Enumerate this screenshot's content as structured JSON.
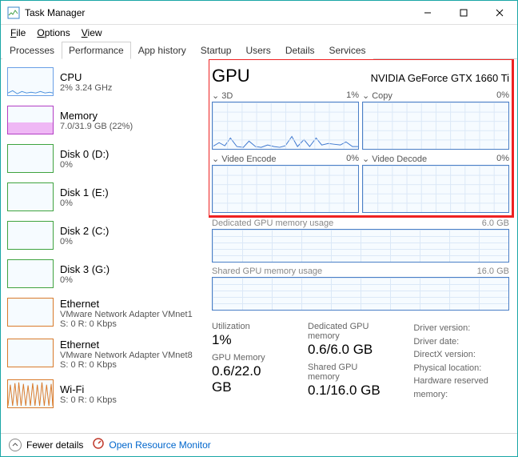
{
  "window": {
    "title": "Task Manager"
  },
  "menu": {
    "file": "File",
    "options": "Options",
    "view": "View"
  },
  "tabs": [
    "Processes",
    "Performance",
    "App history",
    "Startup",
    "Users",
    "Details",
    "Services"
  ],
  "activeTab": "Performance",
  "sidebar": [
    {
      "name": "CPU",
      "sub": "2% 3.24 GHz",
      "kind": "cpu"
    },
    {
      "name": "Memory",
      "sub": "7.0/31.9 GB (22%)",
      "kind": "mem"
    },
    {
      "name": "Disk 0 (D:)",
      "sub": "0%",
      "kind": "disk"
    },
    {
      "name": "Disk 1 (E:)",
      "sub": "0%",
      "kind": "disk"
    },
    {
      "name": "Disk 2 (C:)",
      "sub": "0%",
      "kind": "disk"
    },
    {
      "name": "Disk 3 (G:)",
      "sub": "0%",
      "kind": "disk"
    },
    {
      "name": "Ethernet",
      "sub": "VMware Network Adapter VMnet1",
      "sub2": "S: 0 R: 0 Kbps",
      "kind": "eth"
    },
    {
      "name": "Ethernet",
      "sub": "VMware Network Adapter VMnet8",
      "sub2": "S: 0 R: 0 Kbps",
      "kind": "eth"
    },
    {
      "name": "Wi-Fi",
      "sub": "",
      "sub2": "S: 0 R: 0 Kbps",
      "kind": "eth"
    }
  ],
  "gpu": {
    "heading": "GPU",
    "device": "NVIDIA GeForce GTX 1660 Ti",
    "panels": {
      "p3d": {
        "label": "3D",
        "pct": "1%"
      },
      "copy": {
        "label": "Copy",
        "pct": "0%"
      },
      "venc": {
        "label": "Video Encode",
        "pct": "0%"
      },
      "vdec": {
        "label": "Video Decode",
        "pct": "0%"
      }
    },
    "dedmem": {
      "label": "Dedicated GPU memory usage",
      "max": "6.0 GB"
    },
    "shrmem": {
      "label": "Shared GPU memory usage",
      "max": "16.0 GB"
    },
    "stats": {
      "util_l": "Utilization",
      "util_v": "1%",
      "gpumem_l": "GPU Memory",
      "gpumem_v": "0.6/22.0 GB",
      "dedmem_l": "Dedicated GPU memory",
      "dedmem_v": "0.6/6.0 GB",
      "shrmem_l": "Shared GPU memory",
      "shrmem_v": "0.1/16.0 GB",
      "drv_v": "Driver version:",
      "drv_d": "Driver date:",
      "dx": "DirectX version:",
      "loc": "Physical location:",
      "hw": "Hardware reserved memory:"
    }
  },
  "bottom": {
    "fewer": "Fewer details",
    "rm": "Open Resource Monitor"
  },
  "chart_data": {
    "type": "line",
    "title": "GPU 3D engine utilization",
    "ylabel": "%",
    "ylim": [
      0,
      100
    ],
    "values": [
      4,
      10,
      6,
      18,
      5,
      3,
      12,
      4,
      3,
      2,
      8,
      3,
      2,
      5,
      20,
      3,
      14,
      4,
      18,
      6,
      8,
      7,
      5,
      12,
      4
    ],
    "annotations": {
      "current_pct": 1
    }
  }
}
